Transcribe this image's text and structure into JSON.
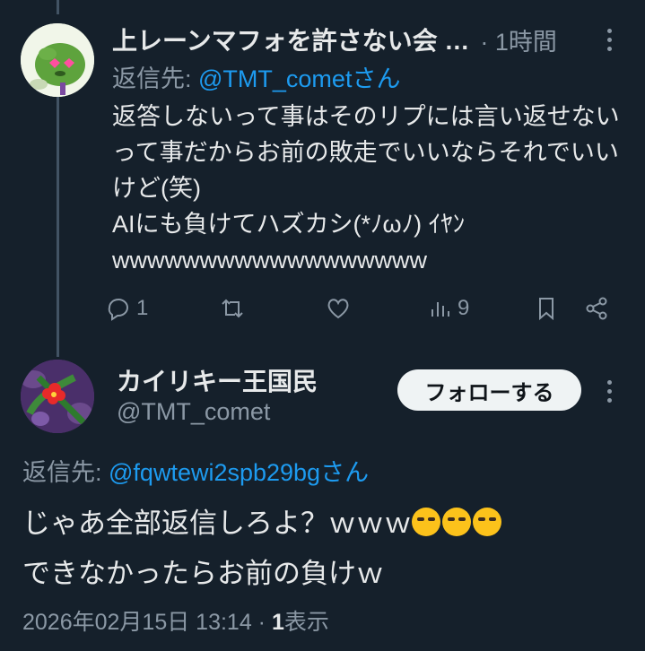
{
  "tweet1": {
    "display_name": "上レーンマフォを許さない会 …",
    "time": "· 1時間",
    "reply_prefix": "返信先: ",
    "reply_to": "@TMT_cometさん",
    "body": "返答しないって事はそのリプには言い返せないって事だからお前の敗走でいいならそれでいいけど(笑)\nAIにも負けてハズカシ(*ﾉωﾉ) ｲﾔﾝ\nwwwwwwwwwwwwwwwwww",
    "actions": {
      "reply_count": "1",
      "retweet_count": "",
      "like_count": "",
      "views_count": "9"
    }
  },
  "tweet2": {
    "display_name": "カイリキー王国民",
    "handle": "@TMT_comet",
    "follow_label": "フォローする",
    "reply_prefix": "返信先: ",
    "reply_to": "@fqwtewi2spb29bgさん",
    "body_line1": "じゃあ全部返信しろよ？ｗｗｗ",
    "body_line2": "できなかったらお前の負けｗ",
    "date": "2026年02月15日 13:14 · ",
    "views_number": "1",
    "views_label": "表示"
  },
  "icons": [
    "reply-icon",
    "retweet-icon",
    "like-icon",
    "views-icon",
    "bookmark-icon",
    "share-icon",
    "more-icon",
    "emoji-rofl-icon"
  ],
  "colors": {
    "background": "#15202b",
    "text": "#e7e9ea",
    "muted": "#8b98a5",
    "link": "#1d9bf0",
    "button": "#eff3f4"
  }
}
